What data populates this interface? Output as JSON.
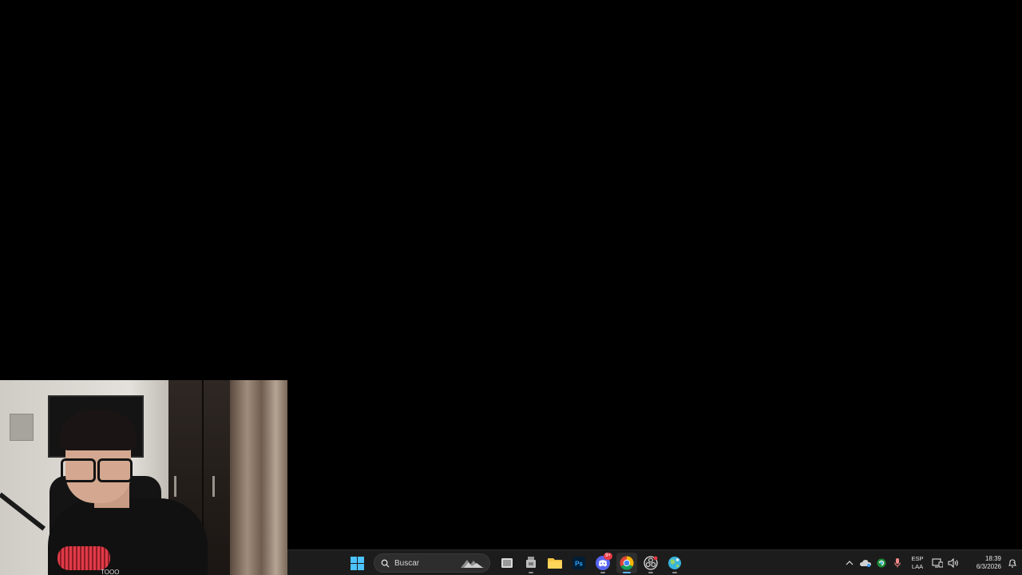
{
  "desktop": {
    "background": "#000000"
  },
  "webcam": {
    "shirt_text": "TOOO"
  },
  "taskbar": {
    "background": "#1c1c1c",
    "accent": "#4cc2ff",
    "search": {
      "placeholder": "Buscar"
    },
    "pinned": [
      {
        "name": "start",
        "icon": "windows-logo-icon"
      },
      {
        "name": "task-view",
        "icon": "task-view-icon"
      },
      {
        "name": "app-gray",
        "icon": "app-icon"
      },
      {
        "name": "file-explorer",
        "icon": "folder-icon"
      },
      {
        "name": "photoshop",
        "icon": "photoshop-icon",
        "label": "Ps"
      },
      {
        "name": "discord",
        "icon": "discord-icon",
        "badge": "9+"
      },
      {
        "name": "chrome",
        "icon": "chrome-icon",
        "active": true
      },
      {
        "name": "obs",
        "icon": "obs-icon"
      },
      {
        "name": "app-globe",
        "icon": "globe-icon"
      }
    ],
    "tray": {
      "language_line1": "ESP",
      "language_line2": "LAA",
      "time": "18:39",
      "date": "6/3/2026"
    }
  }
}
